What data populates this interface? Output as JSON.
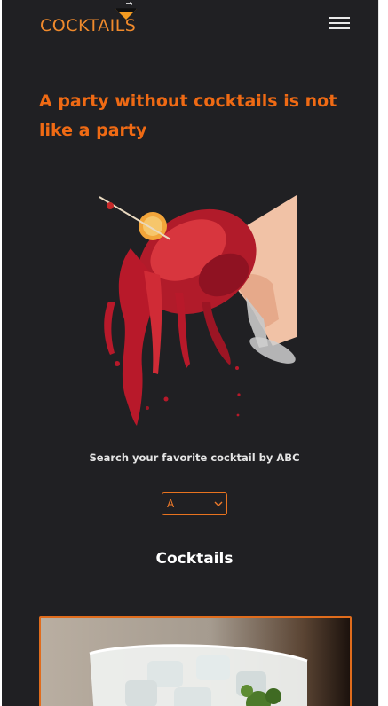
{
  "header": {
    "logo_text": "COCKTAILS",
    "menu_icon": "hamburger-menu-icon"
  },
  "hero": {
    "headline": "A party without cocktails is not like a party",
    "image": "cocktail-splash-image"
  },
  "search": {
    "label": "Search your favorite cocktail by ABC",
    "selected_letter": "A"
  },
  "cocktails": {
    "title": "Cocktails",
    "first_card_image": "cocktail-glass-image"
  },
  "colors": {
    "background": "#202023",
    "accent": "#ef6a14",
    "text_light": "#e4e4e4"
  }
}
